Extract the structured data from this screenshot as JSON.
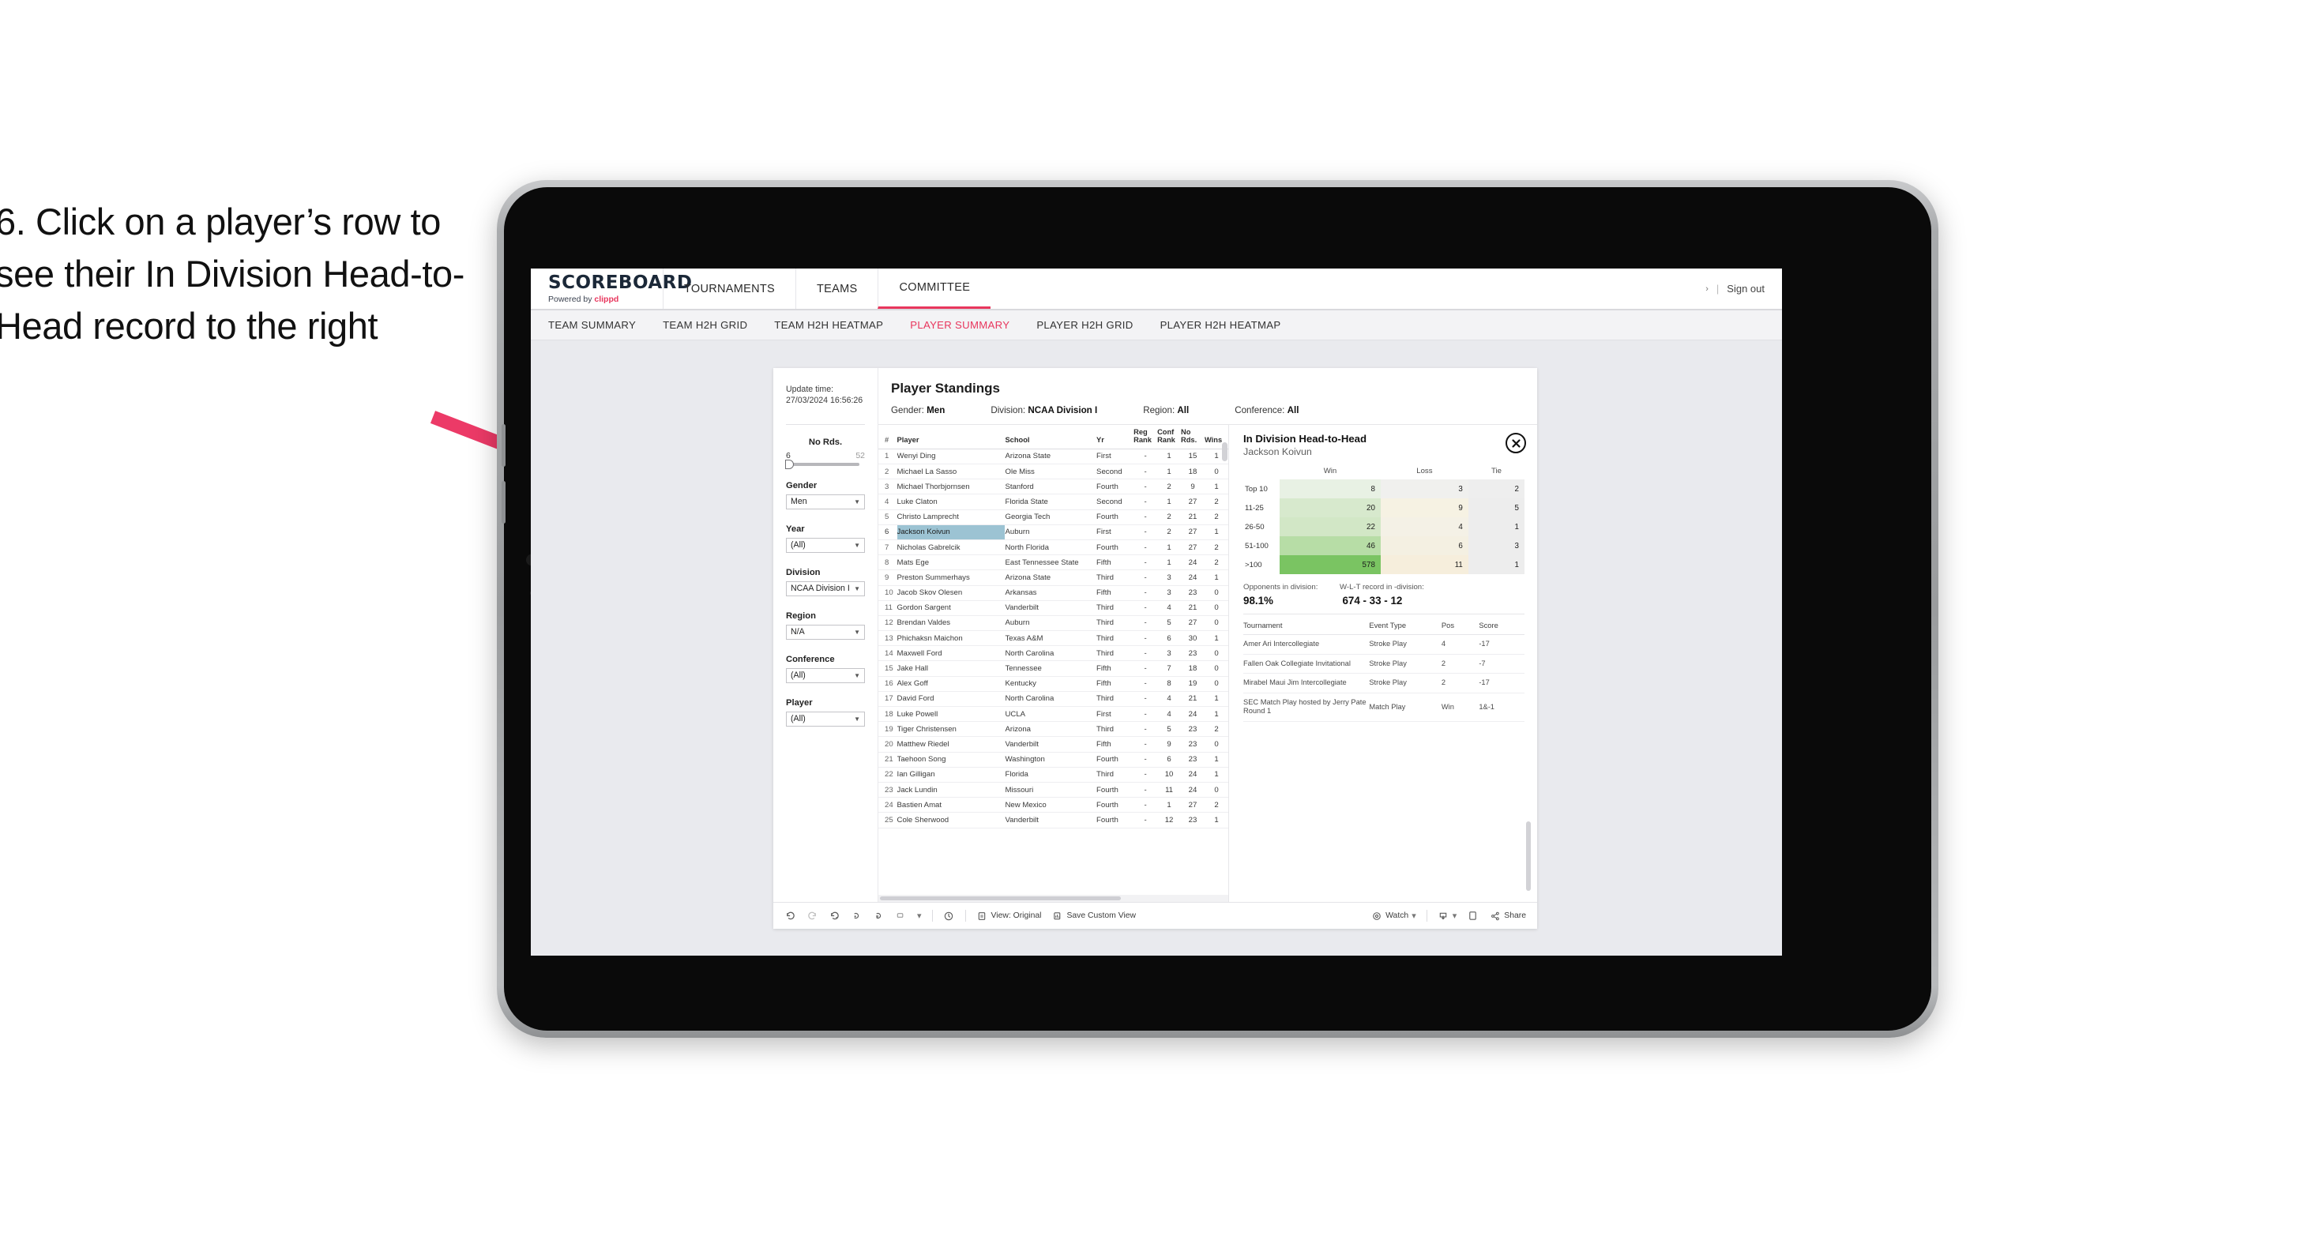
{
  "annotation": {
    "text": "6. Click on a player’s row to see their In Division Head-to-Head record to the right",
    "arrow_color": "#ec3a67"
  },
  "app": {
    "logo_word": "SCOREBOARD",
    "logo_powered_prefix": "Powered by ",
    "logo_brand": "clippd",
    "brand_color": "#e8365d",
    "top_nav": [
      {
        "label": "TOURNAMENTS",
        "active": false
      },
      {
        "label": "TEAMS",
        "active": false
      },
      {
        "label": "COMMITTEE",
        "active": true
      }
    ],
    "top_right": {
      "caret": "›",
      "divider": "|",
      "sign_out": "Sign out"
    },
    "sub_nav": [
      {
        "label": "TEAM SUMMARY",
        "active": false
      },
      {
        "label": "TEAM H2H GRID",
        "active": false
      },
      {
        "label": "TEAM H2H HEATMAP",
        "active": false
      },
      {
        "label": "PLAYER SUMMARY",
        "active": true
      },
      {
        "label": "PLAYER H2H GRID",
        "active": false
      },
      {
        "label": "PLAYER H2H HEATMAP",
        "active": false
      }
    ]
  },
  "filters": {
    "update_label": "Update time:",
    "update_value": "27/03/2024 16:56:26",
    "slider": {
      "title": "No Rds.",
      "low": "6",
      "high": "52"
    },
    "dropdowns": [
      {
        "title": "Gender",
        "value": "Men"
      },
      {
        "title": "Year",
        "value": "(All)"
      },
      {
        "title": "Division",
        "value": "NCAA Division I"
      },
      {
        "title": "Region",
        "value": "N/A"
      },
      {
        "title": "Conference",
        "value": "(All)"
      },
      {
        "title": "Player",
        "value": "(All)"
      }
    ]
  },
  "standings": {
    "title": "Player Standings",
    "meta": [
      {
        "label": "Gender:",
        "value": "Men"
      },
      {
        "label": "Division:",
        "value": "NCAA Division I"
      },
      {
        "label": "Region:",
        "value": "All"
      },
      {
        "label": "Conference:",
        "value": "All"
      }
    ],
    "columns": [
      "#",
      "Player",
      "School",
      "Yr",
      "Reg Rank",
      "Conf Rank",
      "No Rds.",
      "Wins"
    ],
    "selected_row_index": 5,
    "selected_highlight_color": "#9cc3d3",
    "rows": [
      {
        "rank": "1",
        "player": "Wenyi Ding",
        "school": "Arizona State",
        "yr": "First",
        "reg": "-",
        "conf": "1",
        "rds": "15",
        "wins": "1"
      },
      {
        "rank": "2",
        "player": "Michael La Sasso",
        "school": "Ole Miss",
        "yr": "Second",
        "reg": "-",
        "conf": "1",
        "rds": "18",
        "wins": "0"
      },
      {
        "rank": "3",
        "player": "Michael Thorbjornsen",
        "school": "Stanford",
        "yr": "Fourth",
        "reg": "-",
        "conf": "2",
        "rds": "9",
        "wins": "1"
      },
      {
        "rank": "4",
        "player": "Luke Claton",
        "school": "Florida State",
        "yr": "Second",
        "reg": "-",
        "conf": "1",
        "rds": "27",
        "wins": "2"
      },
      {
        "rank": "5",
        "player": "Christo Lamprecht",
        "school": "Georgia Tech",
        "yr": "Fourth",
        "reg": "-",
        "conf": "2",
        "rds": "21",
        "wins": "2"
      },
      {
        "rank": "6",
        "player": "Jackson Koivun",
        "school": "Auburn",
        "yr": "First",
        "reg": "-",
        "conf": "2",
        "rds": "27",
        "wins": "1"
      },
      {
        "rank": "7",
        "player": "Nicholas Gabrelcik",
        "school": "North Florida",
        "yr": "Fourth",
        "reg": "-",
        "conf": "1",
        "rds": "27",
        "wins": "2"
      },
      {
        "rank": "8",
        "player": "Mats Ege",
        "school": "East Tennessee State",
        "yr": "Fifth",
        "reg": "-",
        "conf": "1",
        "rds": "24",
        "wins": "2"
      },
      {
        "rank": "9",
        "player": "Preston Summerhays",
        "school": "Arizona State",
        "yr": "Third",
        "reg": "-",
        "conf": "3",
        "rds": "24",
        "wins": "1"
      },
      {
        "rank": "10",
        "player": "Jacob Skov Olesen",
        "school": "Arkansas",
        "yr": "Fifth",
        "reg": "-",
        "conf": "3",
        "rds": "23",
        "wins": "0"
      },
      {
        "rank": "11",
        "player": "Gordon Sargent",
        "school": "Vanderbilt",
        "yr": "Third",
        "reg": "-",
        "conf": "4",
        "rds": "21",
        "wins": "0"
      },
      {
        "rank": "12",
        "player": "Brendan Valdes",
        "school": "Auburn",
        "yr": "Third",
        "reg": "-",
        "conf": "5",
        "rds": "27",
        "wins": "0"
      },
      {
        "rank": "13",
        "player": "Phichaksn Maichon",
        "school": "Texas A&M",
        "yr": "Third",
        "reg": "-",
        "conf": "6",
        "rds": "30",
        "wins": "1"
      },
      {
        "rank": "14",
        "player": "Maxwell Ford",
        "school": "North Carolina",
        "yr": "Third",
        "reg": "-",
        "conf": "3",
        "rds": "23",
        "wins": "0"
      },
      {
        "rank": "15",
        "player": "Jake Hall",
        "school": "Tennessee",
        "yr": "Fifth",
        "reg": "-",
        "conf": "7",
        "rds": "18",
        "wins": "0"
      },
      {
        "rank": "16",
        "player": "Alex Goff",
        "school": "Kentucky",
        "yr": "Fifth",
        "reg": "-",
        "conf": "8",
        "rds": "19",
        "wins": "0"
      },
      {
        "rank": "17",
        "player": "David Ford",
        "school": "North Carolina",
        "yr": "Third",
        "reg": "-",
        "conf": "4",
        "rds": "21",
        "wins": "1"
      },
      {
        "rank": "18",
        "player": "Luke Powell",
        "school": "UCLA",
        "yr": "First",
        "reg": "-",
        "conf": "4",
        "rds": "24",
        "wins": "1"
      },
      {
        "rank": "19",
        "player": "Tiger Christensen",
        "school": "Arizona",
        "yr": "Third",
        "reg": "-",
        "conf": "5",
        "rds": "23",
        "wins": "2"
      },
      {
        "rank": "20",
        "player": "Matthew Riedel",
        "school": "Vanderbilt",
        "yr": "Fifth",
        "reg": "-",
        "conf": "9",
        "rds": "23",
        "wins": "0"
      },
      {
        "rank": "21",
        "player": "Taehoon Song",
        "school": "Washington",
        "yr": "Fourth",
        "reg": "-",
        "conf": "6",
        "rds": "23",
        "wins": "1"
      },
      {
        "rank": "22",
        "player": "Ian Gilligan",
        "school": "Florida",
        "yr": "Third",
        "reg": "-",
        "conf": "10",
        "rds": "24",
        "wins": "1"
      },
      {
        "rank": "23",
        "player": "Jack Lundin",
        "school": "Missouri",
        "yr": "Fourth",
        "reg": "-",
        "conf": "11",
        "rds": "24",
        "wins": "0"
      },
      {
        "rank": "24",
        "player": "Bastien Amat",
        "school": "New Mexico",
        "yr": "Fourth",
        "reg": "-",
        "conf": "1",
        "rds": "27",
        "wins": "2"
      },
      {
        "rank": "25",
        "player": "Cole Sherwood",
        "school": "Vanderbilt",
        "yr": "Fourth",
        "reg": "-",
        "conf": "12",
        "rds": "23",
        "wins": "1"
      }
    ]
  },
  "h2h": {
    "title": "In Division Head-to-Head",
    "player": "Jackson Koivun",
    "close_icon": "close-circle-icon",
    "chart_data": {
      "type": "heatmap",
      "title": "In Division Head-to-Head",
      "xlabel": "",
      "ylabel": "",
      "columns": [
        "Win",
        "Loss",
        "Tie"
      ],
      "categories": [
        "Top 10",
        "11-25",
        "26-50",
        "51-100",
        ">100"
      ],
      "rows": [
        {
          "bucket": "Top 10",
          "win": 8,
          "loss": 3,
          "tie": 2
        },
        {
          "bucket": "11-25",
          "win": 20,
          "loss": 9,
          "tie": 5
        },
        {
          "bucket": "26-50",
          "win": 22,
          "loss": 4,
          "tie": 1
        },
        {
          "bucket": "51-100",
          "win": 46,
          "loss": 6,
          "tie": 3
        },
        {
          "bucket": ">100",
          "win": 578,
          "loss": 11,
          "tie": 1
        }
      ],
      "win_cell_colors": [
        "#e8f1e4",
        "#d7e9cd",
        "#d2e7c6",
        "#b7dda6",
        "#7ac462"
      ],
      "loss_cell_colors": [
        "#f0f0ee",
        "#f6f2e3",
        "#f4f1e6",
        "#f4f0e2",
        "#f6eedc"
      ],
      "tie_cell_colors": [
        "#eeeeee",
        "#ededed",
        "#ededed",
        "#ededed",
        "#ededed"
      ]
    },
    "stats": [
      {
        "label": "Opponents in division:",
        "value": "98.1%"
      },
      {
        "label": "W-L-T record in -division:",
        "value": "674 - 33 - 12"
      }
    ],
    "tournament_columns": [
      "Tournament",
      "Event Type",
      "Pos",
      "Score"
    ],
    "tournaments": [
      {
        "name": "Amer Ari Intercollegiate",
        "type": "Stroke Play",
        "pos": "4",
        "score": "-17"
      },
      {
        "name": "Fallen Oak Collegiate Invitational",
        "type": "Stroke Play",
        "pos": "2",
        "score": "-7"
      },
      {
        "name": "Mirabel Maui Jim Intercollegiate",
        "type": "Stroke Play",
        "pos": "2",
        "score": "-17"
      },
      {
        "name": "SEC Match Play hosted by Jerry Pate Round 1",
        "type": "Match Play",
        "pos": "Win",
        "score": "1&-1"
      }
    ]
  },
  "toolbar": {
    "icons": [
      "undo-icon",
      "redo-icon",
      "revert-icon",
      "refresh-icon",
      "pause-icon",
      "dashboard-icon"
    ],
    "view_label": "View: Original",
    "save_label": "Save Custom View",
    "watch_label": "Watch",
    "share_label": "Share",
    "caret": "▾"
  }
}
